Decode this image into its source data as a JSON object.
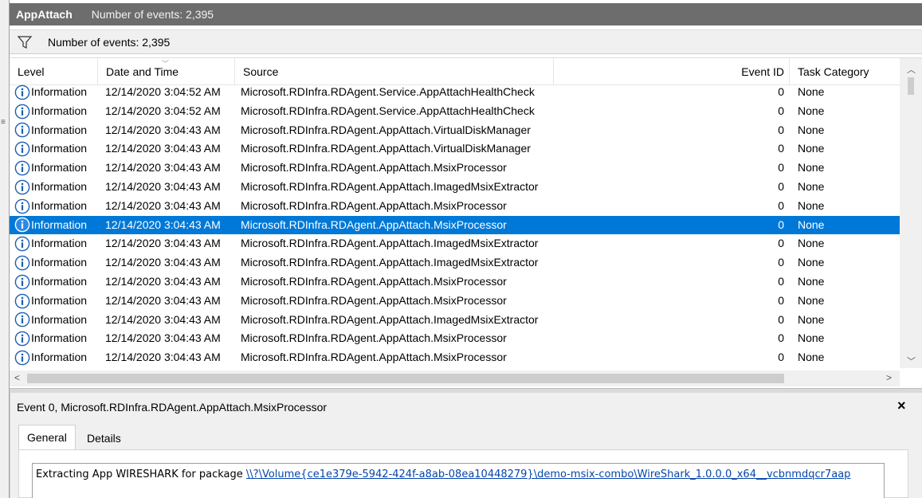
{
  "titlebar": {
    "name": "AppAttach",
    "count": "Number of events: 2,395"
  },
  "filter": {
    "label": "Number of events: 2,395"
  },
  "columns": {
    "level": "Level",
    "date": "Date and Time",
    "source": "Source",
    "event_id": "Event ID",
    "task": "Task Category"
  },
  "rows": [
    {
      "level": "Information",
      "date": "12/14/2020 3:04:52 AM",
      "source": "Microsoft.RDInfra.RDAgent.Service.AppAttachHealthCheck",
      "event_id": "0",
      "task": "None"
    },
    {
      "level": "Information",
      "date": "12/14/2020 3:04:52 AM",
      "source": "Microsoft.RDInfra.RDAgent.Service.AppAttachHealthCheck",
      "event_id": "0",
      "task": "None"
    },
    {
      "level": "Information",
      "date": "12/14/2020 3:04:43 AM",
      "source": "Microsoft.RDInfra.RDAgent.AppAttach.VirtualDiskManager",
      "event_id": "0",
      "task": "None"
    },
    {
      "level": "Information",
      "date": "12/14/2020 3:04:43 AM",
      "source": "Microsoft.RDInfra.RDAgent.AppAttach.VirtualDiskManager",
      "event_id": "0",
      "task": "None"
    },
    {
      "level": "Information",
      "date": "12/14/2020 3:04:43 AM",
      "source": "Microsoft.RDInfra.RDAgent.AppAttach.MsixProcessor",
      "event_id": "0",
      "task": "None"
    },
    {
      "level": "Information",
      "date": "12/14/2020 3:04:43 AM",
      "source": "Microsoft.RDInfra.RDAgent.AppAttach.ImagedMsixExtractor",
      "event_id": "0",
      "task": "None"
    },
    {
      "level": "Information",
      "date": "12/14/2020 3:04:43 AM",
      "source": "Microsoft.RDInfra.RDAgent.AppAttach.MsixProcessor",
      "event_id": "0",
      "task": "None"
    },
    {
      "level": "Information",
      "date": "12/14/2020 3:04:43 AM",
      "source": "Microsoft.RDInfra.RDAgent.AppAttach.MsixProcessor",
      "event_id": "0",
      "task": "None"
    },
    {
      "level": "Information",
      "date": "12/14/2020 3:04:43 AM",
      "source": "Microsoft.RDInfra.RDAgent.AppAttach.ImagedMsixExtractor",
      "event_id": "0",
      "task": "None"
    },
    {
      "level": "Information",
      "date": "12/14/2020 3:04:43 AM",
      "source": "Microsoft.RDInfra.RDAgent.AppAttach.ImagedMsixExtractor",
      "event_id": "0",
      "task": "None"
    },
    {
      "level": "Information",
      "date": "12/14/2020 3:04:43 AM",
      "source": "Microsoft.RDInfra.RDAgent.AppAttach.MsixProcessor",
      "event_id": "0",
      "task": "None"
    },
    {
      "level": "Information",
      "date": "12/14/2020 3:04:43 AM",
      "source": "Microsoft.RDInfra.RDAgent.AppAttach.MsixProcessor",
      "event_id": "0",
      "task": "None"
    },
    {
      "level": "Information",
      "date": "12/14/2020 3:04:43 AM",
      "source": "Microsoft.RDInfra.RDAgent.AppAttach.ImagedMsixExtractor",
      "event_id": "0",
      "task": "None"
    },
    {
      "level": "Information",
      "date": "12/14/2020 3:04:43 AM",
      "source": "Microsoft.RDInfra.RDAgent.AppAttach.MsixProcessor",
      "event_id": "0",
      "task": "None"
    },
    {
      "level": "Information",
      "date": "12/14/2020 3:04:43 AM",
      "source": "Microsoft.RDInfra.RDAgent.AppAttach.MsixProcessor",
      "event_id": "0",
      "task": "None"
    }
  ],
  "selected_row": 7,
  "detail": {
    "title": "Event 0, Microsoft.RDInfra.RDAgent.AppAttach.MsixProcessor",
    "close": "×",
    "tabs": [
      "General",
      "Details"
    ],
    "message_prefix": "Extracting App WIRESHARK for package ",
    "message_link": "\\\\?\\Volume{ce1e379e-5942-424f-a8ab-08ea10448279}\\demo-msix-combo\\WireShark_1.0.0.0_x64__vcbnmdqcr7aap"
  },
  "icons": {
    "filter": "filter-icon",
    "info": "information-icon",
    "close": "close-icon"
  },
  "colors": {
    "selection": "#0078d7",
    "titlebar": "#6d6d6d",
    "info_icon": "#1c5fb3",
    "link": "#0645ad"
  }
}
